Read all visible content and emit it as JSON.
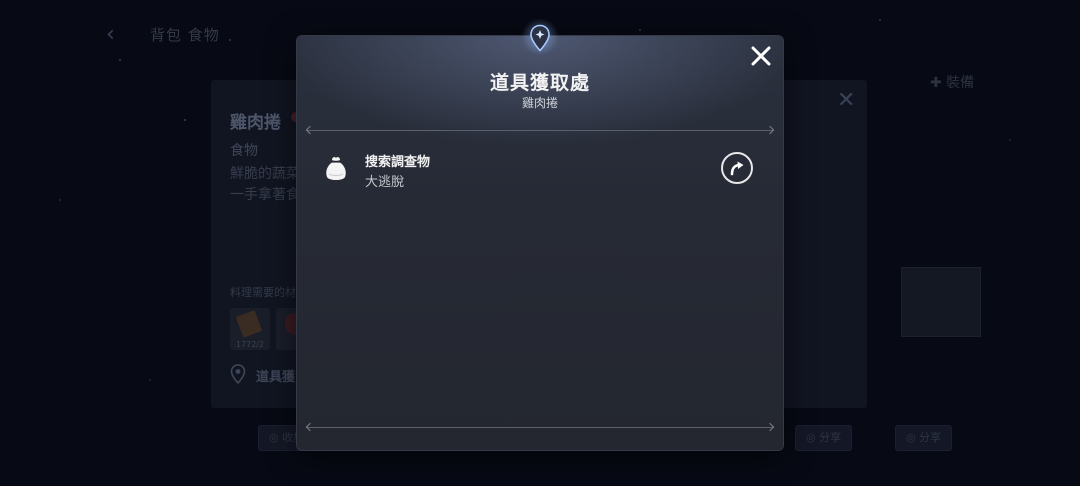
{
  "background": {
    "back_arrow": "‹",
    "crumb": "背包 食物",
    "item_card": {
      "name": "雞肉捲",
      "category": "食物",
      "description_line1": "鮮脆的蔬菜",
      "description_line2": "一手拿著食",
      "recipe_label": "料理需要的材",
      "ingredients": [
        {
          "count": "1772/2"
        },
        {
          "count": ""
        }
      ],
      "source_label": "道具獲",
      "close_glyph": "✕"
    },
    "right_tag": "✚ 裝備",
    "bottom_pills": [
      "◎ 收集",
      "◎ 分享",
      "◎ 分享"
    ]
  },
  "modal": {
    "title": "道具獲取處",
    "subtitle": "雞肉捲",
    "close_icon": "close-icon",
    "sources": [
      {
        "name": "搜索調查物",
        "sub": "大逃脫",
        "icon": "pouch-icon",
        "action_icon": "go-arrow-icon"
      }
    ]
  },
  "colors": {
    "modal_bg": "#262a35",
    "backdrop": "#070a14",
    "title": "#f2f2f2",
    "accent_glow": "#96beff"
  }
}
